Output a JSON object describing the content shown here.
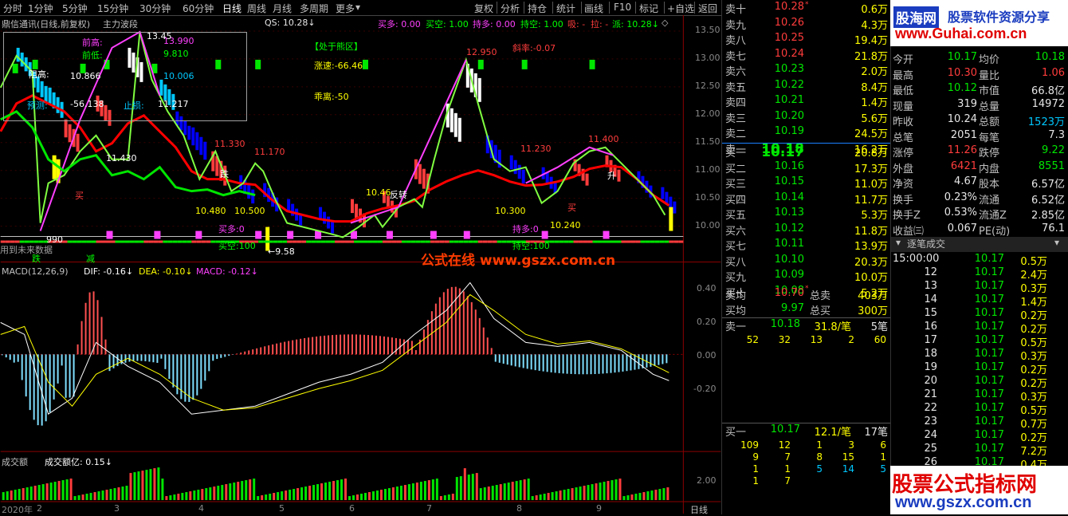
{
  "menu": {
    "items": [
      "分时",
      "1分钟",
      "5分钟",
      "15分钟",
      "30分钟",
      "60分钟",
      "日线",
      "周线",
      "月线",
      "多周期",
      "更多"
    ],
    "active": "日线",
    "more_arrow": "▾"
  },
  "toolbar": [
    "复权",
    "分析",
    "持仓",
    "统计",
    "画线",
    "F10",
    "标记",
    "+自选",
    "返回"
  ],
  "header": {
    "stock": "鼎信通讯(日线,前复权)",
    "indicator": "主力波段",
    "qs": "QS: 10.28↓",
    "buy_more": "买多: 0.00",
    "buy_empty": "买空: 1.00",
    "hold_more": "持多: 0.00",
    "hold_empty": "持空: 1.00",
    "absorb": "吸: -",
    "pull": "拉: -",
    "dispatch": "派: 10.28↓"
  },
  "price_axis": [
    "13.50",
    "13.00",
    "12.50",
    "12.00",
    "11.50",
    "11.00",
    "10.50",
    "10.00"
  ],
  "annotations": {
    "zone": "【处于熊区】",
    "speed": "涨速:-66.46",
    "deviation": "乖离:-50",
    "slope": "斜率:-0.07",
    "front_high_label": "前高:",
    "front_low_label": "前低:",
    "box_13_990": "13.990",
    "box_9_810": "9.810",
    "box_high": "阻高:",
    "box_10_866": "10.866",
    "box_10_006": "10.006",
    "forecast": "预测:",
    "forecast_val": "-56.138",
    "stoploss": "止损:",
    "stoploss_val": "11.217",
    "p13_45": "13.45",
    "p12_950": "12.950",
    "p11_330": "11.330",
    "p11_170": "11.170",
    "p11_230": "11.230",
    "p11_400": "11.400",
    "p11_430": "11.430",
    "p10_480": "10.480",
    "p10_500": "10.500",
    "p10_46": "10.46",
    "p10_300": "10.300",
    "p10_240": "10.240",
    "p9_58": "←9.58",
    "p9_990": "990",
    "buy_more_0": "买多:0",
    "buy_empty_100": "买空:100",
    "hold_more_0": "持多:0",
    "hold_empty_100": "持空:100",
    "fall": "跌",
    "buy": "买",
    "reverse": "反转",
    "rise": "升",
    "note_text": "用到未来数据",
    "drop": "跌",
    "reduce": "减"
  },
  "watermark_mid": "公式在线  www.gszx.com.cn",
  "macd": {
    "title": "MACD(12,26,9)",
    "dif": "DIF: -0.16↓",
    "dea": "DEA: -0.10↓",
    "macd": "MACD: -0.12↓",
    "axis": [
      "0.40",
      "0.20",
      "0.00",
      "-0.20"
    ]
  },
  "volume": {
    "title": "成交额",
    "value": "成交额亿: 0.15↓",
    "axis": [
      "2.00"
    ]
  },
  "date_axis": [
    "2020年",
    "2",
    "3",
    "4",
    "5",
    "6",
    "7",
    "8",
    "9"
  ],
  "period_label": "日线",
  "colors": {
    "up": "#ff3c3c",
    "down": "#00e600",
    "bg": "#000000",
    "grid": "#8b0000",
    "yellow": "#ffff00",
    "magenta": "#ff40ff",
    "cyan": "#00c8ff"
  },
  "order_book": {
    "asks": [
      {
        "label": "卖十",
        "price": "10.28",
        "vol": "0.6万",
        "mark": "*"
      },
      {
        "label": "卖九",
        "price": "10.26",
        "vol": "4.3万"
      },
      {
        "label": "卖八",
        "price": "10.25",
        "vol": "19.4万"
      },
      {
        "label": "卖七",
        "price": "10.24",
        "vol": "21.8万"
      },
      {
        "label": "卖六",
        "price": "10.23",
        "vol": "2.0万"
      },
      {
        "label": "卖五",
        "price": "10.22",
        "vol": "8.4万"
      },
      {
        "label": "卖四",
        "price": "10.21",
        "vol": "1.4万"
      },
      {
        "label": "卖三",
        "price": "10.20",
        "vol": "5.6万"
      },
      {
        "label": "卖二",
        "price": "10.19",
        "vol": "24.5万"
      },
      {
        "label": "卖一",
        "price": "10.18",
        "vol": "16.2万"
      }
    ],
    "bids": [
      {
        "label": "买一",
        "price": "10.17",
        "vol": "20.8万"
      },
      {
        "label": "买二",
        "price": "10.16",
        "vol": "17.3万"
      },
      {
        "label": "买三",
        "price": "10.15",
        "vol": "11.0万"
      },
      {
        "label": "买四",
        "price": "10.14",
        "vol": "11.7万"
      },
      {
        "label": "买五",
        "price": "10.13",
        "vol": "5.3万"
      },
      {
        "label": "买六",
        "price": "10.12",
        "vol": "11.8万"
      },
      {
        "label": "买七",
        "price": "10.11",
        "vol": "13.9万"
      },
      {
        "label": "买八",
        "price": "10.10",
        "vol": "20.3万"
      },
      {
        "label": "买九",
        "price": "10.09",
        "vol": "10.0万"
      },
      {
        "label": "买十",
        "price": "10.08",
        "vol": "5.2万",
        "mark": "*"
      }
    ],
    "avg_sell": {
      "label": "卖均",
      "price": "10.70",
      "total_label": "总卖",
      "total": "403万"
    },
    "avg_buy": {
      "label": "买均",
      "price": "9.97",
      "total_label": "总买",
      "total": "300万"
    },
    "sell1_queue": {
      "label": "卖一",
      "price": "10.18",
      "per": "31.8/笔",
      "count": "5笔",
      "items": [
        "52",
        "32",
        "13",
        "2",
        "60"
      ]
    },
    "buy1_queue": {
      "label": "买一",
      "price": "10.17",
      "per": "12.1/笔",
      "count": "17笔",
      "items": [
        "109",
        "12",
        "1",
        "3",
        "6",
        "9",
        "7",
        "8",
        "15",
        "1",
        "1",
        "1",
        "5",
        "14",
        "5",
        "1",
        "7"
      ]
    }
  },
  "stats": [
    {
      "l1": "今开",
      "v1": "10.17",
      "l2": "均价",
      "v2": "10.18"
    },
    {
      "l1": "最高",
      "v1": "10.30",
      "l2": "量比",
      "v2": "1.06"
    },
    {
      "l1": "最低",
      "v1": "10.12",
      "l2": "市值",
      "v2": "66.8亿"
    },
    {
      "l1": "现量",
      "v1": "319",
      "l2": "总量",
      "v2": "14972"
    },
    {
      "l1": "昨收",
      "v1": "10.24",
      "l2": "总额",
      "v2": "1523万"
    },
    {
      "l1": "总笔",
      "v1": "2051",
      "l2": "每笔",
      "v2": "7.3"
    },
    {
      "l1": "涨停",
      "v1": "11.26",
      "l2": "跌停",
      "v2": "9.22"
    },
    {
      "l1": "外盘",
      "v1": "6421",
      "l2": "内盘",
      "v2": "8551"
    },
    {
      "l1": "净资",
      "v1": "4.67",
      "l2": "股本",
      "v2": "6.57亿"
    },
    {
      "l1": "换手",
      "v1": "0.23%",
      "l2": "流通",
      "v2": "6.52亿"
    },
    {
      "l1": "换手Z",
      "v1": "0.53%",
      "l2": "流通Z",
      "v2": "2.85亿"
    },
    {
      "l1": "收益㈢",
      "v1": "0.067",
      "l2": "PE(动)",
      "v2": "76.1"
    }
  ],
  "ticks": {
    "title": "逐笔成交",
    "rows": [
      {
        "t": "15:00:00",
        "p": "10.17",
        "v": "0.5万"
      },
      {
        "t": "12",
        "p": "10.17",
        "v": "2.4万"
      },
      {
        "t": "13",
        "p": "10.17",
        "v": "0.3万"
      },
      {
        "t": "14",
        "p": "10.17",
        "v": "1.4万"
      },
      {
        "t": "15",
        "p": "10.17",
        "v": "0.2万"
      },
      {
        "t": "16",
        "p": "10.17",
        "v": "0.2万"
      },
      {
        "t": "17",
        "p": "10.17",
        "v": "0.5万"
      },
      {
        "t": "18",
        "p": "10.17",
        "v": "0.3万"
      },
      {
        "t": "19",
        "p": "10.17",
        "v": "0.2万"
      },
      {
        "t": "20",
        "p": "10.17",
        "v": "0.2万"
      },
      {
        "t": "21",
        "p": "10.17",
        "v": "0.3万"
      },
      {
        "t": "22",
        "p": "10.17",
        "v": "0.5万"
      },
      {
        "t": "23",
        "p": "10.17",
        "v": "0.7万"
      },
      {
        "t": "24",
        "p": "10.17",
        "v": "0.2万"
      },
      {
        "t": "25",
        "p": "10.17",
        "v": "7.2万"
      },
      {
        "t": "26",
        "p": "10.17",
        "v": "0.4万"
      }
    ]
  },
  "logo_top": {
    "brand": "股海网",
    "slogan": "股票软件资源分享",
    "url": "www.Guhai.com.cn"
  },
  "logo_bottom": {
    "brand": "股票公式指标网",
    "url": "www.gszx.com.cn"
  }
}
